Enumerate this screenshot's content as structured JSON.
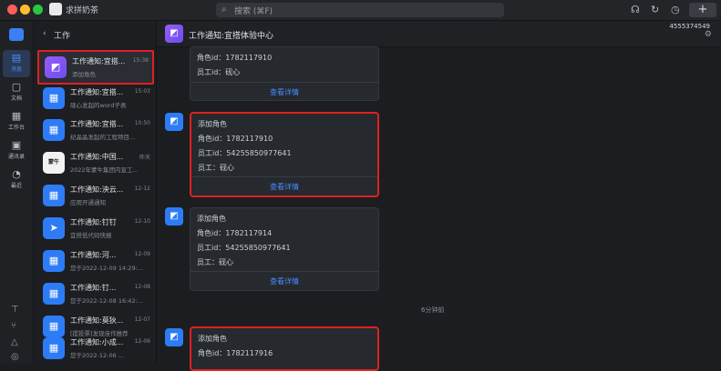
{
  "window": {
    "title": "求拼奶茶"
  },
  "search": {
    "placeholder": "搜索 (⌘F)"
  },
  "icons": {
    "search": "search-icon",
    "headset": "headset-icon",
    "refresh": "refresh-icon",
    "history": "history-icon",
    "plus": "plus-icon"
  },
  "rail": {
    "items": [
      {
        "label": "消息",
        "icon": "chat-icon"
      },
      {
        "label": "文档",
        "icon": "doc-icon"
      },
      {
        "label": "工作台",
        "icon": "grid-icon"
      },
      {
        "label": "通讯录",
        "icon": "contacts-icon"
      },
      {
        "label": "最近",
        "icon": "recent-icon"
      }
    ]
  },
  "list": {
    "back": "‹",
    "title": "工作",
    "items": [
      {
        "name": "工作通知:宜搭...",
        "time": "15:38",
        "preview": "添加角色"
      },
      {
        "name": "工作通知:宜搭...",
        "time": "15:03",
        "preview": "砚心发起的word子表"
      },
      {
        "name": "工作通知:宜搭...",
        "time": "10:50",
        "preview": "纪晶晶发起的工程项目..."
      },
      {
        "name": "工作通知:中国...",
        "time": "昨天",
        "preview": "2022年蒙牛集团内宣工...",
        "avatar": "蒙牛"
      },
      {
        "name": "工作通知:泱云...",
        "time": "12-12",
        "preview": "应用开通通知"
      },
      {
        "name": "工作通知:钉钉",
        "time": "12-10",
        "preview": "宜搭低代码快报"
      },
      {
        "name": "工作通知:河...",
        "time": "12-09",
        "preview": "您于2022-12-09 14:29:..."
      },
      {
        "name": "工作通知:钉...",
        "time": "12-08",
        "preview": "您于2022-12-08 16:42:..."
      },
      {
        "name": "工作通知:莫狄...",
        "time": "12-07",
        "preview": "[提投票]发现佳作推荐"
      },
      {
        "name": "工作通知:小成...",
        "time": "12-06",
        "preview": "您于2022-12-06 ..."
      }
    ]
  },
  "chat": {
    "title": "工作通知:宜搭体验中心",
    "id_badge": "4555374549",
    "time_separator": "6分钟前",
    "cards": [
      {
        "lines": [
          "角色id：1782117910",
          "员工id：砚心"
        ],
        "detail": "查看详情"
      },
      {
        "title": "添加角色",
        "lines": [
          "角色id：1782117910",
          "员工id：54255850977641",
          "员工：砚心"
        ],
        "detail": "查看详情"
      },
      {
        "title": "添加角色",
        "lines": [
          "角色id：1782117914",
          "员工id：54255850977641",
          "员工：砚心"
        ],
        "detail": "查看详情"
      },
      {
        "title": "添加角色",
        "lines": [
          "角色id：1782117916"
        ]
      }
    ]
  }
}
